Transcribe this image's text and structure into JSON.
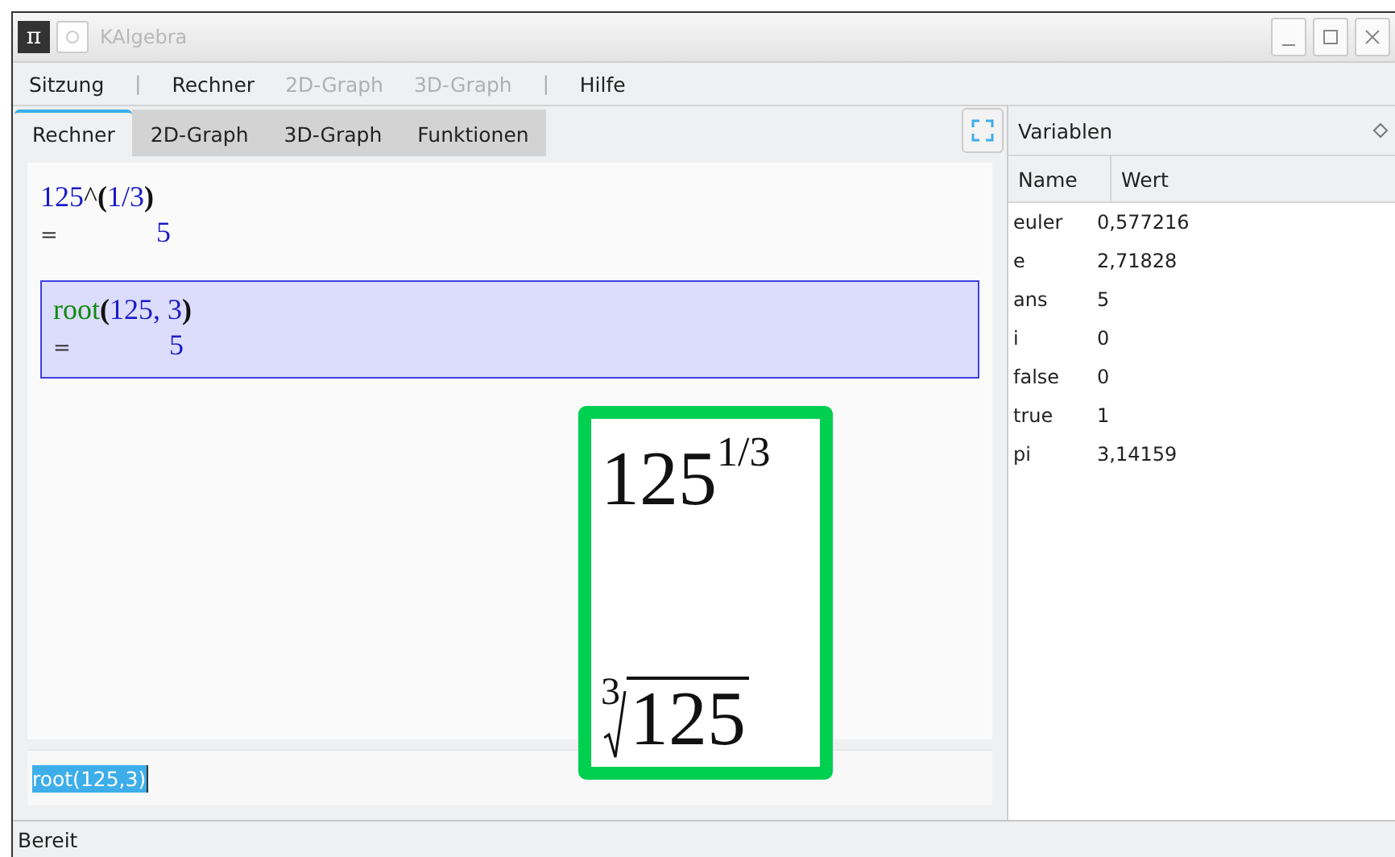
{
  "window": {
    "title": "KAlgebra",
    "icon": "π"
  },
  "menu": [
    {
      "label": "Sitzung",
      "disabled": false
    },
    {
      "kind": "separator",
      "label": "|"
    },
    {
      "label": "Rechner",
      "disabled": false
    },
    {
      "label": "2D-Graph",
      "disabled": true
    },
    {
      "label": "3D-Graph",
      "disabled": true
    },
    {
      "kind": "separator",
      "label": "|"
    },
    {
      "label": "Hilfe",
      "disabled": false
    }
  ],
  "tabs": [
    {
      "label": "Rechner",
      "selected": true
    },
    {
      "label": "2D-Graph",
      "selected": false
    },
    {
      "label": "3D-Graph",
      "selected": false
    },
    {
      "label": "Funktionen",
      "selected": false
    }
  ],
  "calculations": [
    {
      "selected": false,
      "expression": [
        {
          "kind": "number",
          "text": "125"
        },
        {
          "kind": "operator",
          "text": "^"
        },
        {
          "kind": "paren",
          "text": "("
        },
        {
          "kind": "number",
          "text": "1/3"
        },
        {
          "kind": "paren",
          "text": ")"
        }
      ],
      "equals": "=",
      "result": "5"
    },
    {
      "selected": true,
      "expression": [
        {
          "kind": "function",
          "text": "root"
        },
        {
          "kind": "paren",
          "text": "("
        },
        {
          "kind": "number",
          "text": "125, 3"
        },
        {
          "kind": "paren",
          "text": ")"
        }
      ],
      "equals": "=",
      "result": "5"
    }
  ],
  "input": {
    "value": "root(125,3)"
  },
  "overlay": {
    "power": {
      "base": "125",
      "exponent": "1/3"
    },
    "root": {
      "index": "3",
      "radicand": "125"
    }
  },
  "variables": {
    "title": "Variablen",
    "columns": [
      "Name",
      "Wert"
    ],
    "rows": [
      [
        "euler",
        "0,577216"
      ],
      [
        "e",
        "2,71828"
      ],
      [
        "ans",
        "5"
      ],
      [
        "i",
        "0"
      ],
      [
        "false",
        "0"
      ],
      [
        "true",
        "1"
      ],
      [
        "pi",
        "3,14159"
      ]
    ]
  },
  "status_bar": "Bereit"
}
